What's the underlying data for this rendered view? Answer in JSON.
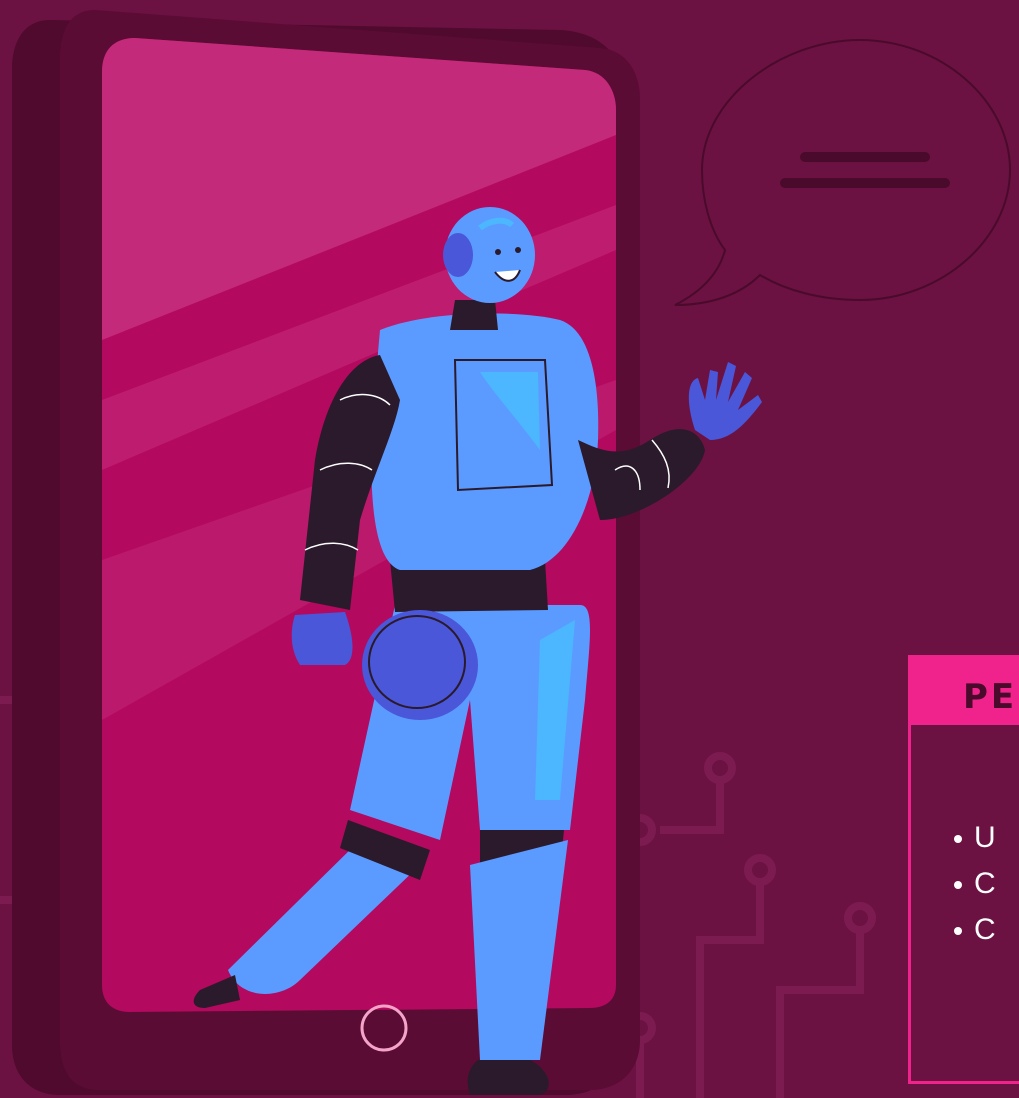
{
  "colors": {
    "background": "#6b1242",
    "phone_frame": "#4f0a2e",
    "phone_screen": "#b3095e",
    "accent_pink": "#f0238c",
    "robot_blue": "#5b9bff",
    "robot_dark": "#2a1a2c"
  },
  "card": {
    "title": "PE",
    "items": [
      "U",
      "C",
      "C"
    ]
  },
  "speech_bubble": {
    "icon": "text-lines-icon"
  },
  "phone": {
    "home_button_icon": "circle-home-icon"
  }
}
